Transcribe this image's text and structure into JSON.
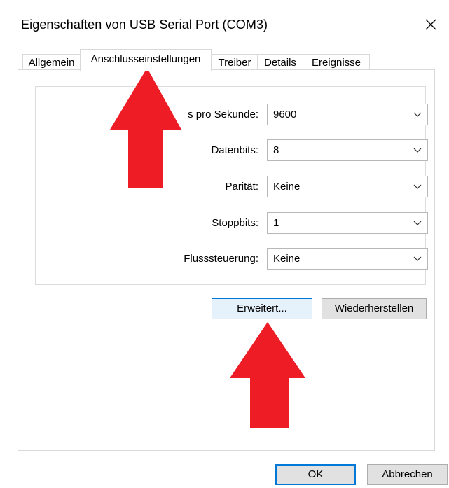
{
  "window": {
    "title": "Eigenschaften von USB Serial Port (COM3)"
  },
  "tabs": [
    {
      "label": "Allgemein"
    },
    {
      "label": "Anschlusseinstellungen"
    },
    {
      "label": "Treiber"
    },
    {
      "label": "Details"
    },
    {
      "label": "Ereignisse"
    }
  ],
  "settings": {
    "bits_per_second": {
      "label": "s pro Sekunde:",
      "value": "9600"
    },
    "data_bits": {
      "label": "Datenbits:",
      "value": "8"
    },
    "parity": {
      "label": "Parität:",
      "value": "Keine"
    },
    "stop_bits": {
      "label": "Stoppbits:",
      "value": "1"
    },
    "flow_control": {
      "label": "Flusssteuerung:",
      "value": "Keine"
    }
  },
  "buttons": {
    "advanced": "Erweitert...",
    "restore": "Wiederherstellen",
    "ok": "OK",
    "cancel": "Abbrechen"
  },
  "colors": {
    "annotation_arrow": "#ee1c25",
    "accent": "#0078d7"
  }
}
